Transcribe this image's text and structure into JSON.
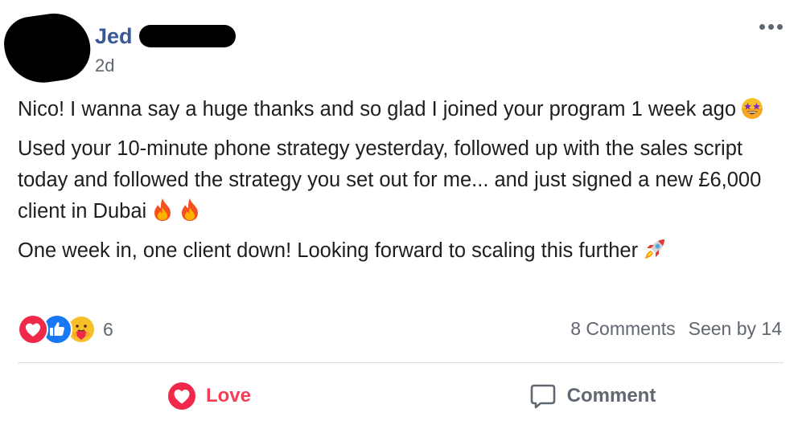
{
  "post": {
    "author_first_name": "Jed",
    "timestamp": "2d",
    "body_lines": [
      "Nico! I wanna say a huge thanks and so glad I joined your program 1 week ago",
      "Used your 10-minute phone strategy yesterday, followed up with the sales script today and followed the strategy you set out for me... and just signed a new £6,000 client in Dubai",
      "One week in, one client down! Looking forward to scaling this further"
    ],
    "emojis": [
      "star-struck-emoji",
      "fire-emoji",
      "fire-emoji",
      "rocket-emoji"
    ]
  },
  "reactions": {
    "icons": [
      "love-reaction-icon",
      "like-reaction-icon",
      "care-reaction-icon"
    ],
    "count": "6"
  },
  "meta": {
    "comments": "8 Comments",
    "seen_by": "Seen by 14"
  },
  "actions": {
    "love_label": "Love",
    "comment_label": "Comment"
  },
  "colors": {
    "author": "#385898",
    "secondary_text": "#606770",
    "love": "#f33e58",
    "like": "#1877f2",
    "divider": "#dadde1"
  }
}
